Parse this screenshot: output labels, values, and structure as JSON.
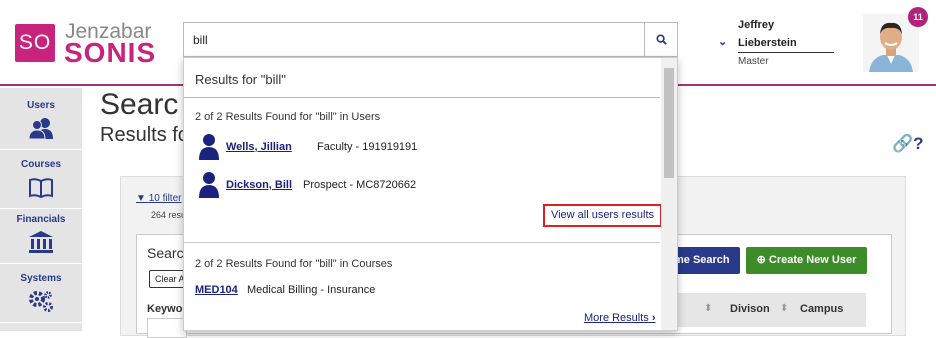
{
  "header": {
    "logo_badge": "SO",
    "logo_line1": "Jenzabar",
    "logo_line2": "SONIS",
    "search_value": "bill",
    "user": {
      "first": "Jeffrey",
      "last": "Lieberstein",
      "role": "Master"
    },
    "notification_count": "11"
  },
  "sidebar": {
    "items": [
      {
        "label": "Users",
        "icon": "users-icon"
      },
      {
        "label": "Courses",
        "icon": "book-icon"
      },
      {
        "label": "Financials",
        "icon": "bank-icon"
      },
      {
        "label": "Systems",
        "icon": "gears-icon"
      }
    ]
  },
  "main": {
    "title": "Searc",
    "subtitle": "Results fo",
    "link_icons": "🔗?",
    "filters_link": "10 filter",
    "results_count": "264 resu",
    "inner_title": "Searc",
    "clear_btn": "Clear A",
    "keyword_label": "Keywo",
    "name_search_btn": "me Search",
    "create_btn": "Create New User",
    "table_headers": [
      "Divison",
      "Campus"
    ]
  },
  "dropdown": {
    "header": "Results for \"bill\"",
    "users_heading": "2 of 2 Results Found for \"bill\" in Users",
    "users": [
      {
        "name": "Wells, Jillian",
        "detail": "Faculty - 191919191"
      },
      {
        "name": "Dickson, Bill",
        "detail": "Prospect - MC8720662"
      }
    ],
    "view_all_users": "View all users results",
    "courses_heading": "2 of 2 Results Found for \"bill\" in Courses",
    "course": {
      "code": "MED104",
      "name": "Medical Billing - Insurance"
    },
    "more_results": "More Results"
  },
  "colors": {
    "brand": "#c8237d",
    "nav": "#2a3a8a",
    "create": "#3d8c2a",
    "highlight": "#e02020"
  }
}
